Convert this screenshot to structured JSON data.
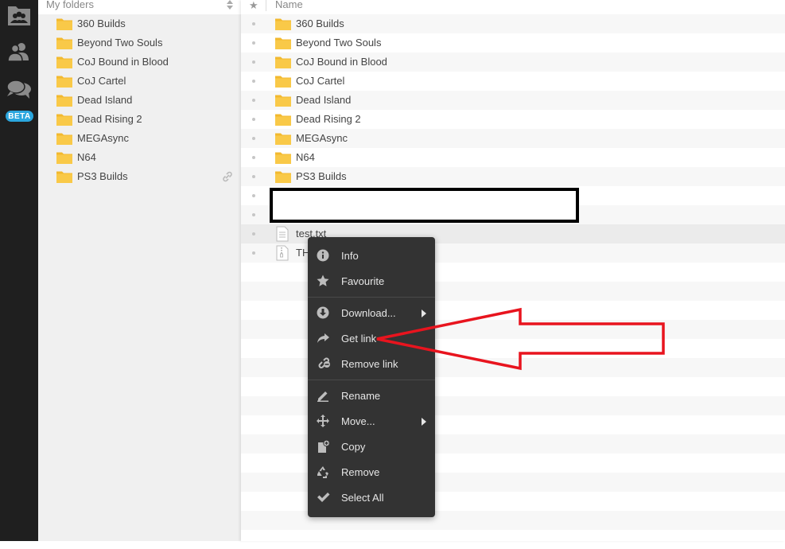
{
  "sidebar": {
    "title": "My folders",
    "folders": [
      {
        "label": "360 Builds"
      },
      {
        "label": "Beyond Two Souls"
      },
      {
        "label": "CoJ Bound in Blood"
      },
      {
        "label": "CoJ Cartel"
      },
      {
        "label": "Dead Island"
      },
      {
        "label": "Dead Rising 2"
      },
      {
        "label": "MEGAsync"
      },
      {
        "label": "N64"
      },
      {
        "label": "PS3 Builds",
        "linked": true
      }
    ]
  },
  "rail": {
    "badge": "BETA",
    "icons": [
      "cloud-drive-icon",
      "contacts-icon",
      "chat-icon"
    ]
  },
  "list": {
    "star_header": "★",
    "name_header": "Name",
    "rows": [
      {
        "label": "360 Builds",
        "type": "folder"
      },
      {
        "label": "Beyond Two Souls",
        "type": "folder"
      },
      {
        "label": "CoJ Bound in Blood",
        "type": "folder"
      },
      {
        "label": "CoJ Cartel",
        "type": "folder"
      },
      {
        "label": "Dead Island",
        "type": "folder"
      },
      {
        "label": "Dead Rising 2",
        "type": "folder"
      },
      {
        "label": "MEGAsync",
        "type": "folder"
      },
      {
        "label": "N64",
        "type": "folder"
      },
      {
        "label": "PS3 Builds",
        "type": "folder"
      },
      {
        "label": "",
        "type": "redacted"
      },
      {
        "label": "",
        "type": "redacted"
      },
      {
        "label": "test.txt",
        "type": "text-file",
        "selected": true
      },
      {
        "label": "TH",
        "type": "zip-file"
      }
    ]
  },
  "context_menu": {
    "items": [
      {
        "label": "Info",
        "icon": "info-icon"
      },
      {
        "label": "Favourite",
        "icon": "star-icon"
      },
      {
        "label": "Download...",
        "icon": "download-icon",
        "submenu": true
      },
      {
        "label": "Get link",
        "icon": "share-arrow-icon"
      },
      {
        "label": "Remove link",
        "icon": "unlink-icon"
      },
      {
        "label": "Rename",
        "icon": "pencil-icon"
      },
      {
        "label": "Move...",
        "icon": "move-icon",
        "submenu": true
      },
      {
        "label": "Copy",
        "icon": "copy-icon"
      },
      {
        "label": "Remove",
        "icon": "recycle-icon"
      },
      {
        "label": "Select All",
        "icon": "checkmark-icon"
      }
    ]
  },
  "annotation": {
    "arrow_color": "#e8141e",
    "points_to": "Get link"
  },
  "colors": {
    "rail_bg": "#1f1f1f",
    "sidebar_bg": "#f0f0f0",
    "menu_bg": "#333333",
    "folder_yellow": "#f9c948",
    "beta_badge": "#2ba6de"
  }
}
